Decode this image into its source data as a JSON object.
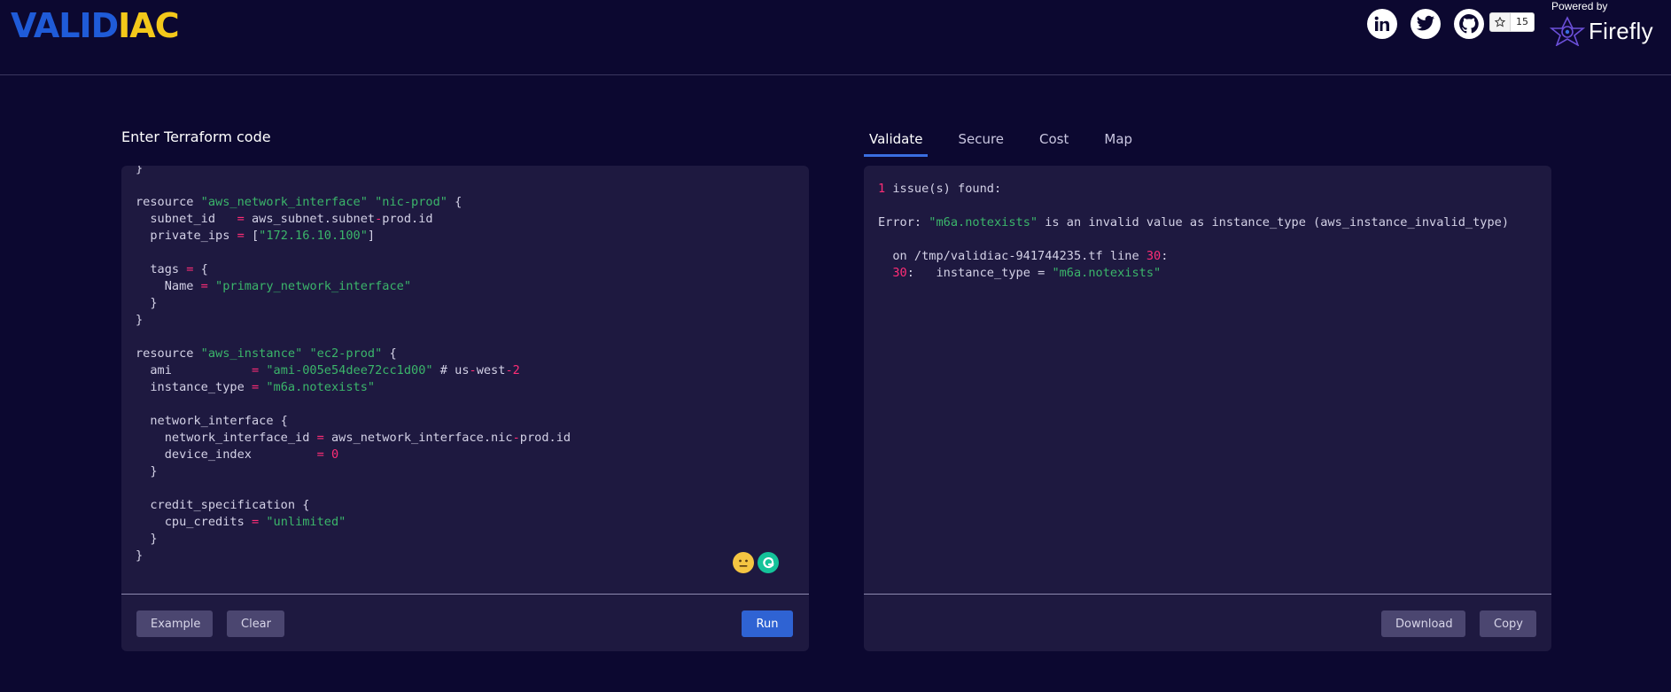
{
  "brand": {
    "part1": "VALID",
    "part2": "IAC"
  },
  "header": {
    "social": [
      {
        "name": "linkedin-icon"
      },
      {
        "name": "twitter-icon"
      },
      {
        "name": "github-icon"
      }
    ],
    "github_stars": "15",
    "powered_by": "Powered by",
    "sponsor": "Firefly"
  },
  "editor": {
    "title": "Enter Terraform code",
    "buttons": {
      "example": "Example",
      "clear": "Clear",
      "run": "Run"
    },
    "lines": [
      "}",
      "",
      "resource \"aws_network_interface\" \"nic-prod\" {",
      "  subnet_id   = aws_subnet.subnet-prod.id",
      "  private_ips = [\"172.16.10.100\"]",
      "",
      "  tags = {",
      "    Name = \"primary_network_interface\"",
      "  }",
      "}",
      "",
      "resource \"aws_instance\" \"ec2-prod\" {",
      "  ami           = \"ami-005e54dee72cc1d00\" # us-west-2",
      "  instance_type = \"m6a.notexists\"",
      "",
      "  network_interface {",
      "    network_interface_id = aws_network_interface.nic-prod.id",
      "    device_index         = 0",
      "  }",
      "",
      "  credit_specification {",
      "    cpu_credits = \"unlimited\"",
      "  }",
      "}"
    ]
  },
  "results": {
    "tabs": [
      "Validate",
      "Secure",
      "Cost",
      "Map"
    ],
    "active_tab": "Validate",
    "buttons": {
      "download": "Download",
      "copy": "Copy"
    },
    "lines": [
      "1 issue(s) found:",
      "",
      "Error: \"m6a.notexists\" is an invalid value as instance_type (aws_instance_invalid_type)",
      "",
      "  on /tmp/validiac-941744235.tf line 30:",
      "  30:   instance_type = \"m6a.notexists\""
    ]
  },
  "colors": {
    "background": "#0c0830",
    "panel": "#1e1940",
    "accent": "#2f63d3",
    "string": "#3bb56a",
    "number": "#ff2d76"
  }
}
